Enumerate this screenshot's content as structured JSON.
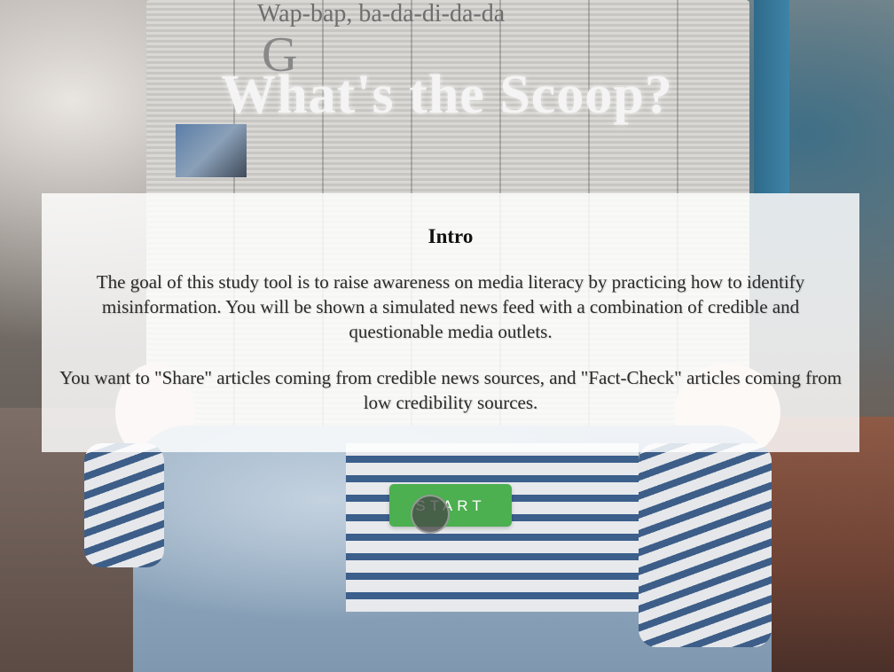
{
  "page": {
    "title": "What's the Scoop?"
  },
  "intro": {
    "heading": "Intro",
    "paragraph_1": "The goal of this study tool is to raise awareness on media literacy by practicing how to identify misinformation. You will be shown a simulated news feed with a combination of credible and questionable media outlets.",
    "paragraph_2": "You want to \"Share\" articles coming from credible news sources, and \"Fact-Check\" articles coming from low credibility sources."
  },
  "actions": {
    "start_label": "START"
  },
  "background": {
    "newspaper_headline": "Wap-bap, ba-da-di-da-da"
  },
  "colors": {
    "start_button": "#4caf50",
    "card_background": "rgba(255,255,255,0.83)",
    "title_text": "#f4f4f4"
  }
}
